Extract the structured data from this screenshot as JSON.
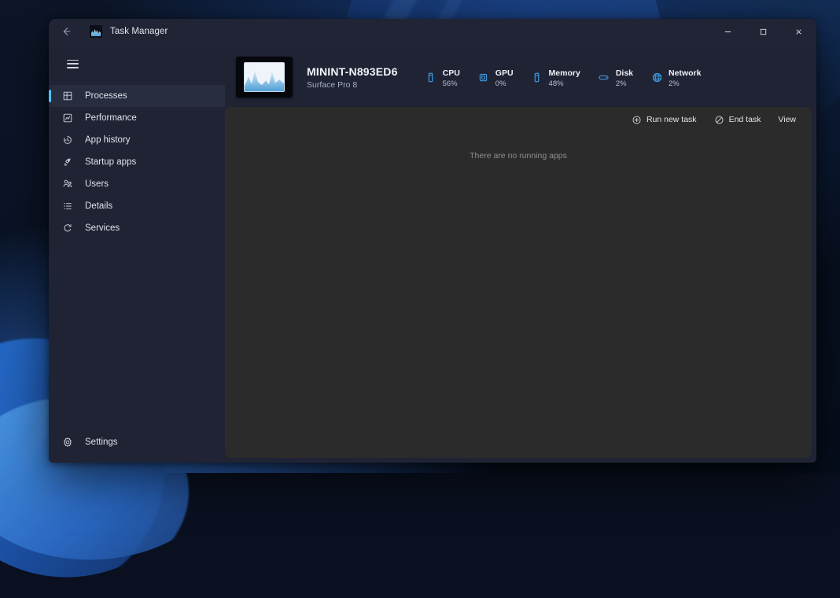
{
  "window": {
    "title": "Task Manager",
    "title_icon": "task-manager-icon",
    "back_icon": "back-arrow-icon",
    "controls": {
      "minimize": "─",
      "maximize": "□",
      "close": "✕"
    }
  },
  "sidebar": {
    "menu_icon": "hamburger-menu-icon",
    "items": [
      {
        "label": "Processes",
        "icon": "processes-grid-icon",
        "active": true
      },
      {
        "label": "Performance",
        "icon": "performance-icon",
        "active": false
      },
      {
        "label": "App history",
        "icon": "history-clock-icon",
        "active": false
      },
      {
        "label": "Startup apps",
        "icon": "rocket-icon",
        "active": false
      },
      {
        "label": "Users",
        "icon": "users-icon",
        "active": false
      },
      {
        "label": "Details",
        "icon": "list-details-icon",
        "active": false
      },
      {
        "label": "Services",
        "icon": "services-gear-icon",
        "active": false
      }
    ],
    "settings": {
      "label": "Settings",
      "icon": "gear-icon"
    }
  },
  "summary": {
    "device_icon": "device-chart-thumbnail",
    "device_name": "MININT-N893ED6",
    "device_model": "Surface Pro 8",
    "stats": [
      {
        "name": "CPU",
        "value": "56%",
        "icon": "cpu-icon"
      },
      {
        "name": "GPU",
        "value": "0%",
        "icon": "gpu-icon"
      },
      {
        "name": "Memory",
        "value": "48%",
        "icon": "memory-icon"
      },
      {
        "name": "Disk",
        "value": "2%",
        "icon": "disk-icon"
      },
      {
        "name": "Network",
        "value": "2%",
        "icon": "network-globe-icon"
      }
    ]
  },
  "toolbar": {
    "run_new_task": "Run new task",
    "run_new_task_icon": "plus-circle-icon",
    "end_task": "End task",
    "end_task_icon": "no-entry-icon",
    "view": "View"
  },
  "content": {
    "empty_message": "There are no running apps"
  },
  "colors": {
    "accent": "#4cc2ff",
    "stat_icon": "#3f9ae0",
    "window_bg": "#1f2333",
    "card_bg": "#2b2b2b",
    "active_row": "#272c3e"
  }
}
